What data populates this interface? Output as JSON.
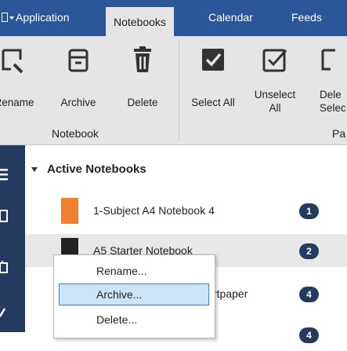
{
  "tabs": [
    {
      "label": "Application",
      "active": false
    },
    {
      "label": "Notebooks",
      "active": true
    },
    {
      "label": "Calendar",
      "active": false
    },
    {
      "label": "Feeds",
      "active": false
    }
  ],
  "ribbon": {
    "buttons": [
      {
        "label": "Rename"
      },
      {
        "label": "Archive"
      },
      {
        "label": "Delete"
      },
      {
        "label": "Select All"
      },
      {
        "label_line1": "Unselect",
        "label_line2": "All"
      },
      {
        "label_line1": "Dele",
        "label_line2": "Selec"
      }
    ],
    "groups": [
      {
        "label": "Notebook"
      },
      {
        "label": "Pa"
      }
    ]
  },
  "section": {
    "title": "Active Notebooks"
  },
  "notebooks": [
    {
      "name": "1-Subject A4 Notebook 4",
      "count": "1",
      "color": "#f08030"
    },
    {
      "name": "A5 Starter Notebook",
      "count": "2",
      "color": "#222222"
    },
    {
      "name": "rtpaper",
      "count": "4",
      "color": "#444444"
    },
    {
      "name": "",
      "count": "4",
      "color": "#444444"
    }
  ],
  "context_menu": {
    "items": [
      {
        "label": "Rename..."
      },
      {
        "label": "Archive..."
      },
      {
        "label": "Delete..."
      }
    ]
  },
  "colors": {
    "tab_bar": "#2b579a",
    "ribbon": "#e5e5e5",
    "rail": "#243a5e",
    "badge": "#243a5e",
    "menu_hover": "#cce4f7"
  }
}
